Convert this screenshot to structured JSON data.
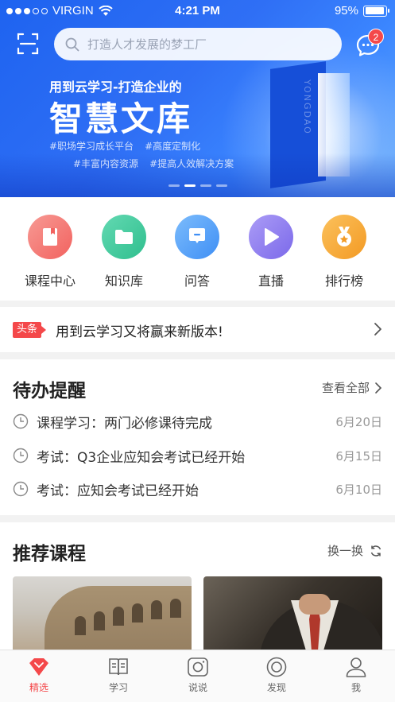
{
  "status_bar": {
    "carrier": "VIRGIN",
    "time": "4:21 PM",
    "battery": "95%",
    "battery_level": 0.95
  },
  "search": {
    "placeholder": "打造人才发展的梦工厂"
  },
  "messages": {
    "badge_count": "2"
  },
  "banner": {
    "subtitle": "用到云学习-打造企业的",
    "title": "智慧文库",
    "tags_row1": [
      "#职场学习成长平台",
      "#高度定制化"
    ],
    "tags_row2": [
      "#丰富内容资源",
      "#提高人效解决方案"
    ],
    "side_text": "YONGDAO",
    "pages": 4,
    "active_page": 1
  },
  "quick_entries": [
    {
      "label": "课程中心",
      "icon": "book-icon",
      "color": "#f4726f"
    },
    {
      "label": "知识库",
      "icon": "folder-icon",
      "color": "#3cc89b"
    },
    {
      "label": "问答",
      "icon": "qa-icon",
      "color": "#4a9cf7"
    },
    {
      "label": "直播",
      "icon": "play-icon",
      "color": "#8c7cf0"
    },
    {
      "label": "排行榜",
      "icon": "medal-icon",
      "color": "#f7a533"
    }
  ],
  "headline": {
    "tag": "头条",
    "text": "用到云学习又将赢来新版本!"
  },
  "todo": {
    "title": "待办提醒",
    "view_all": "查看全部",
    "items": [
      {
        "text": "课程学习：两门必修课待完成",
        "date": "6月20日"
      },
      {
        "text": "考试：Q3企业应知会考试已经开始",
        "date": "6月15日"
      },
      {
        "text": "考试：应知会考试已经开始",
        "date": "6月10日"
      }
    ]
  },
  "recommend": {
    "title": "推荐课程",
    "refresh": "换一换"
  },
  "tabs": [
    {
      "label": "精选",
      "icon": "diamond-icon",
      "active": true
    },
    {
      "label": "学习",
      "icon": "study-book-icon",
      "active": false
    },
    {
      "label": "说说",
      "icon": "camera-icon",
      "active": false
    },
    {
      "label": "发现",
      "icon": "compass-icon",
      "active": false
    },
    {
      "label": "我",
      "icon": "user-icon",
      "active": false
    }
  ],
  "colors": {
    "accent": "#f4484a",
    "banner_blue": "#2f6ff5"
  }
}
